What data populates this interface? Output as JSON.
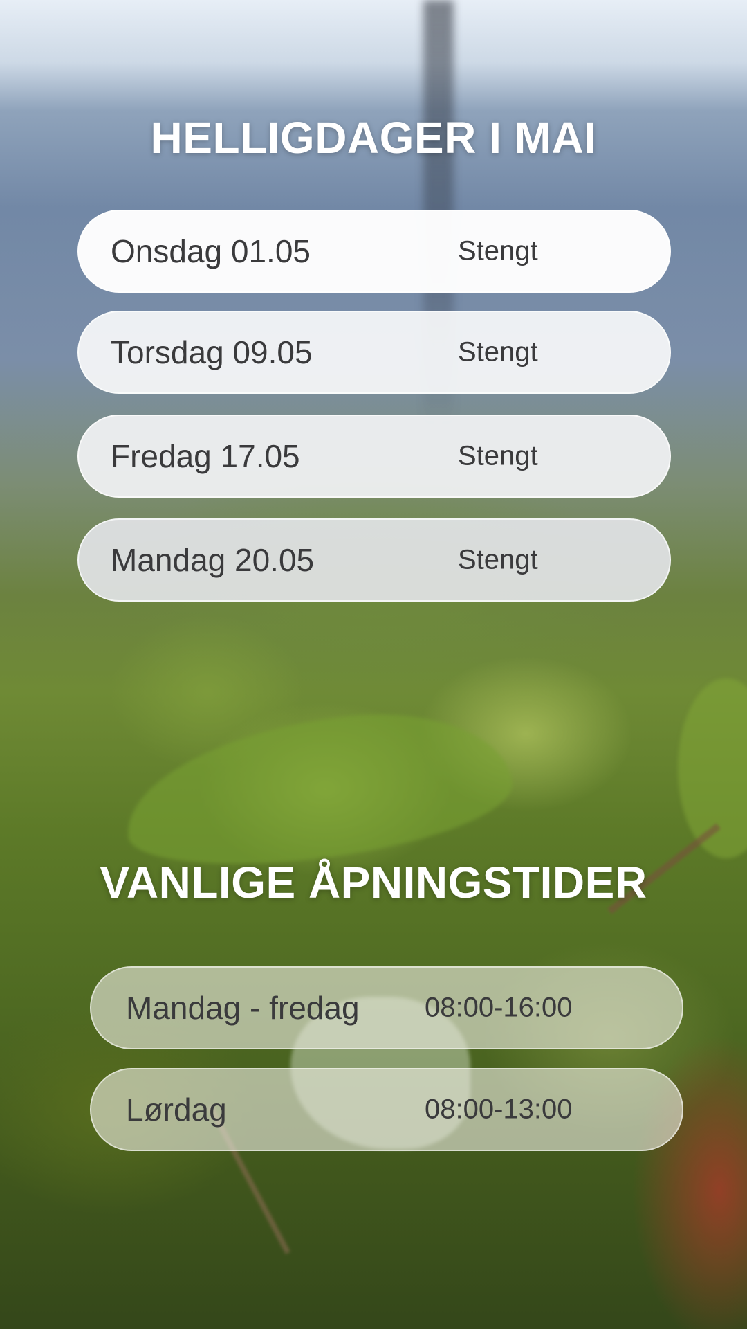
{
  "holidays": {
    "title": "HELLIGDAGER I MAI",
    "items": [
      {
        "day": "Onsdag 01.05",
        "status": "Stengt"
      },
      {
        "day": "Torsdag 09.05",
        "status": "Stengt"
      },
      {
        "day": "Fredag 17.05",
        "status": "Stengt"
      },
      {
        "day": "Mandag 20.05",
        "status": "Stengt"
      }
    ]
  },
  "regular_hours": {
    "title": "VANLIGE ÅPNINGSTIDER",
    "items": [
      {
        "day": "Mandag - fredag",
        "hours": "08:00-16:00"
      },
      {
        "day": "Lørdag",
        "hours": "08:00-13:00"
      }
    ]
  },
  "colors": {
    "title_text": "#ffffff",
    "pill_text": "#3a3a3c",
    "pill_background": "#ffffff"
  }
}
